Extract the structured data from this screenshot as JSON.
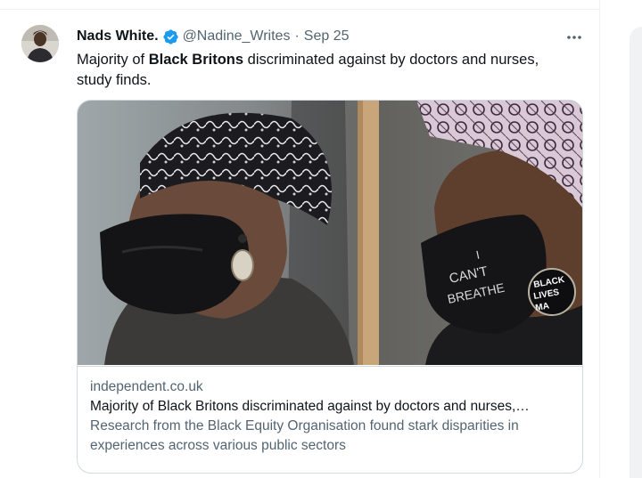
{
  "tweet": {
    "author_name": "Nads White.",
    "handle": "@Nadine_Writes",
    "separator": "·",
    "date": "Sep 25",
    "text_before": "Majority of ",
    "text_bold": "Black Britons",
    "text_after": " discriminated against by doctors and nurses, study finds.",
    "more_icon": "more-horizontal-icon",
    "verified_icon": "verified-badge-icon",
    "accent_color": "#1d9bf0"
  },
  "card": {
    "domain": "independent.co.uk",
    "title": "Majority of Black Britons discriminated against by doctors and nurses,…",
    "description": "Research from the Black Equity Organisation found stark disparities in experiences across various public sectors",
    "mask_text_line1": "I",
    "mask_text_line2": "CAN'T",
    "mask_text_line3": "BREATHE",
    "earring_text_line1": "BLACK",
    "earring_text_line2": "LIVES",
    "earring_text_line3": "MA"
  }
}
